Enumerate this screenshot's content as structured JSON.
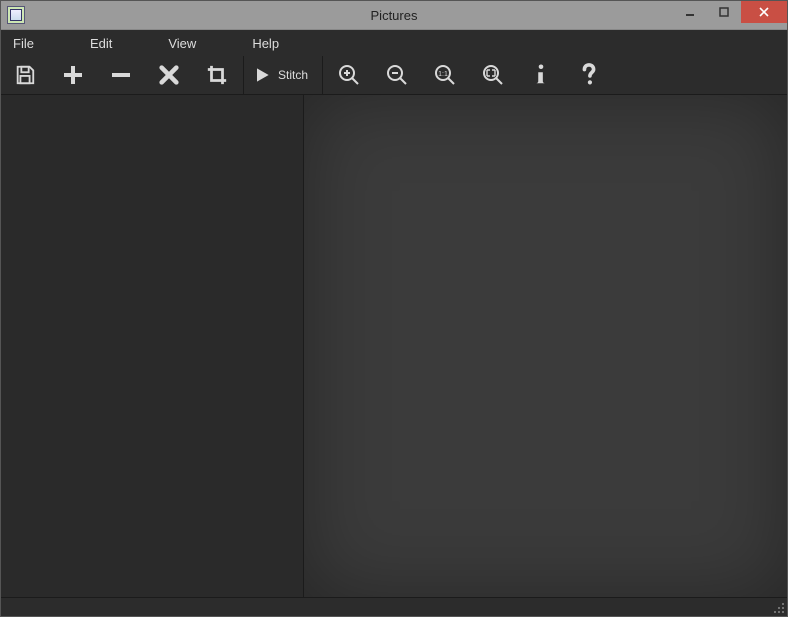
{
  "window": {
    "title": "Pictures"
  },
  "menu": {
    "file": "File",
    "edit": "Edit",
    "view": "View",
    "help": "Help"
  },
  "toolbar": {
    "stitch_label": "Stitch"
  },
  "icons": {
    "save": "save-icon",
    "add": "plus-icon",
    "remove": "minus-icon",
    "delete": "x-icon",
    "crop": "crop-icon",
    "play": "play-icon",
    "zoom_in": "zoom-in-icon",
    "zoom_out": "zoom-out-icon",
    "zoom_11": "zoom-1to1-icon",
    "zoom_fit": "zoom-fit-icon",
    "info": "info-icon",
    "help": "question-icon"
  },
  "colors": {
    "toolbar_bg": "#2c2c2c",
    "canvas_bg": "#3b3b3b",
    "panel_bg": "#2a2a2a",
    "icon": "#d9d9d9",
    "close_btn": "#c94f44"
  }
}
